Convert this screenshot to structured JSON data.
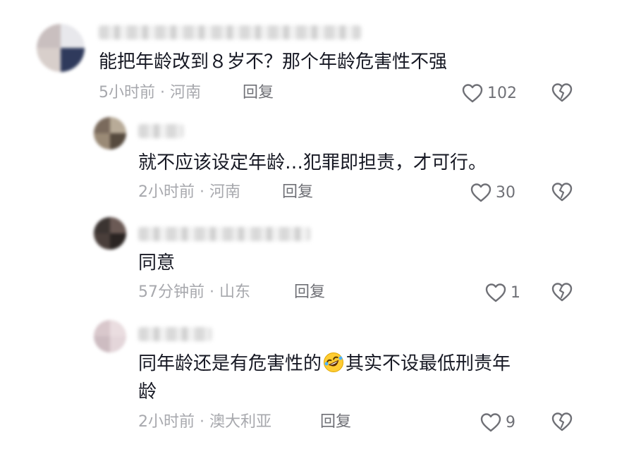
{
  "comments": [
    {
      "text": "能把年龄改到８岁不？那个年龄危害性不强",
      "time": "5小时前",
      "location": "河南",
      "reply_label": "回复",
      "likes": "102",
      "avatar_colors": [
        "#c9bfbf",
        "#e8e8ec",
        "#d8cfcb",
        "#2f3a5c"
      ]
    },
    {
      "text": "就不应该设定年龄…犯罪即担责，才可行。",
      "time": "2小时前",
      "location": "河南",
      "reply_label": "回复",
      "likes": "30",
      "avatar_colors": [
        "#7a6a5c",
        "#b8ab98",
        "#9a8a76",
        "#564a3e"
      ]
    },
    {
      "text": "同意",
      "time": "57分钟前",
      "location": "山东",
      "reply_label": "回复",
      "likes": "1",
      "avatar_colors": [
        "#3b3431",
        "#6b5a55",
        "#4a3f3b",
        "#2a2422"
      ]
    },
    {
      "text_before_emoji": "同年龄还是有危害性的",
      "emoji": "rolling-on-floor-laughing-emoji",
      "text_after_emoji": "其实不设最低刑责年",
      "text_line2": "龄",
      "time": "2小时前",
      "location": "澳大利亚",
      "reply_label": "回复",
      "likes": "9",
      "avatar_colors": [
        "#d9c8cc",
        "#eadde0",
        "#cdbcc1",
        "#e4d6da"
      ]
    }
  ],
  "meta_separator": "·",
  "icons": {
    "like": "heart-outline-icon",
    "dislike": "broken-heart-icon"
  },
  "colors": {
    "text": "#161823",
    "meta": "#a7a8ad",
    "action": "#6f7076"
  }
}
